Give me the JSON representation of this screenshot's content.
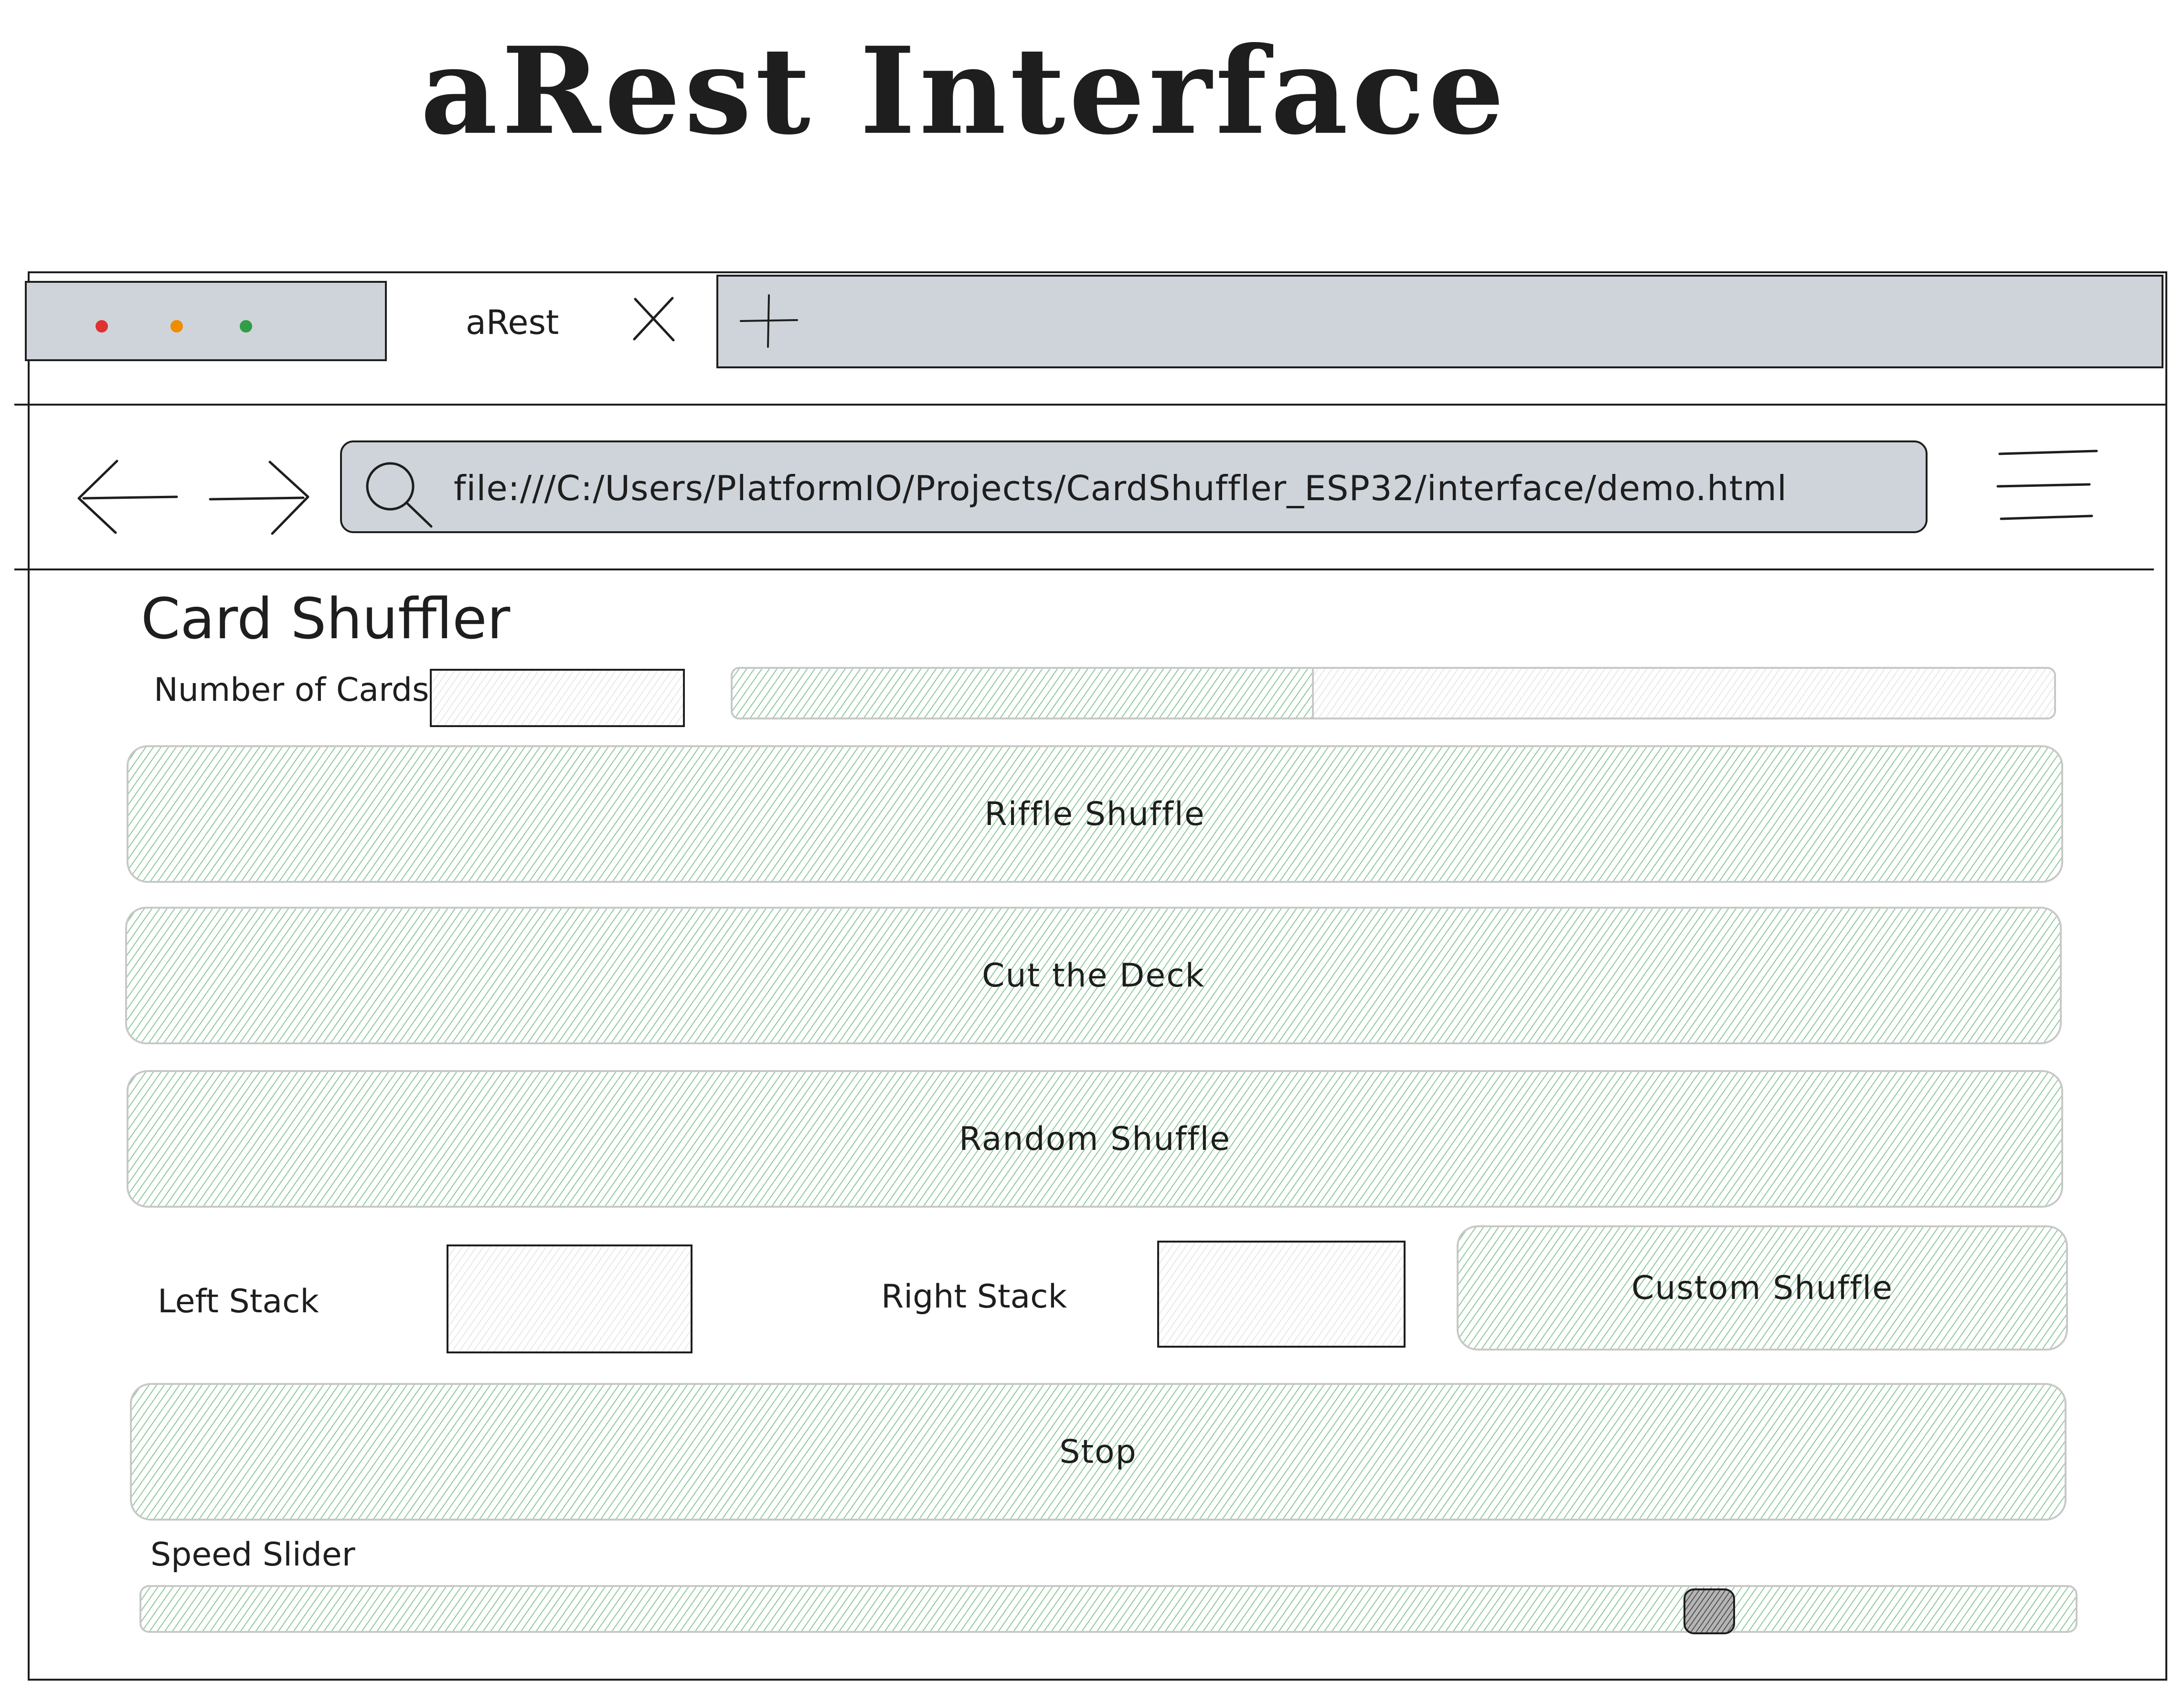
{
  "page": {
    "title": "aRest Interface"
  },
  "browser": {
    "window_dots": [
      {
        "name": "close",
        "color": "#e03131"
      },
      {
        "name": "minimize",
        "color": "#f08c00"
      },
      {
        "name": "maximize",
        "color": "#2f9e44"
      }
    ],
    "tab": {
      "label": "aRest",
      "close_icon": "close-icon"
    },
    "new_tab_icon": "plus-icon",
    "nav": {
      "back_icon": "arrow-left-icon",
      "back_glyph": "←",
      "forward_icon": "arrow-right-icon",
      "forward_glyph": "→"
    },
    "address_bar": {
      "icon": "search-icon",
      "url": "file:///C:/Users/PlatformIO/Projects/CardShuffler_ESP32/interface/demo.html"
    },
    "menu_icon": "hamburger-menu-icon",
    "chrome_color": "#ced4da"
  },
  "app": {
    "title": "Card Shuffler",
    "number_of_cards": {
      "label": "Number of Cards",
      "value": ""
    },
    "progress": {
      "fraction": 0.44
    },
    "buttons": {
      "riffle": "Riffle Shuffle",
      "cut": "Cut the Deck",
      "random": "Random Shuffle",
      "custom": "Custom Shuffle",
      "stop": "Stop"
    },
    "left_stack": {
      "label": "Left Stack",
      "value": ""
    },
    "right_stack": {
      "label": "Right Stack",
      "value": ""
    },
    "speed": {
      "label": "Speed Slider",
      "value": 0.81
    },
    "accent_color": "#2f9e44"
  }
}
